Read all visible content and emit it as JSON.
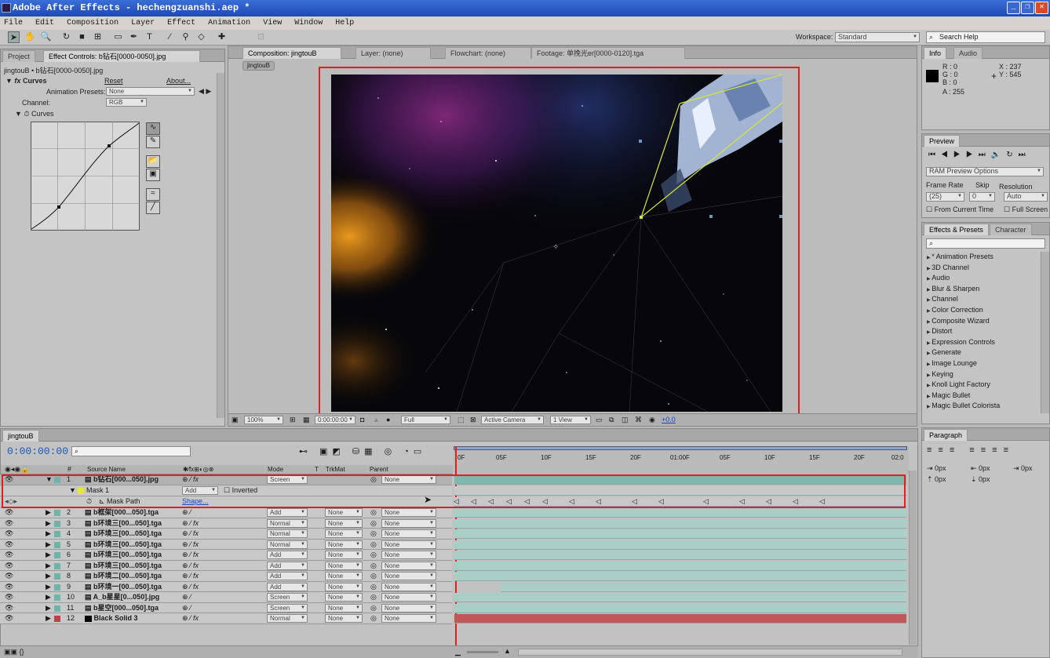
{
  "window": {
    "title": "Adobe After Effects - hechengzuanshi.aep *"
  },
  "menu": [
    "File",
    "Edit",
    "Composition",
    "Layer",
    "Effect",
    "Animation",
    "View",
    "Window",
    "Help"
  ],
  "workspace": {
    "label": "Workspace:",
    "value": "Standard"
  },
  "search_help": "Search Help",
  "left_panel": {
    "tabs": [
      "Project",
      "Effect Controls: b钻石[0000-0050].jpg"
    ],
    "breadcrumb": "jingtouB • b钻石[0000-0050].jpg",
    "effect_name": "Curves",
    "reset": "Reset",
    "about": "About...",
    "animation_presets_label": "Animation Presets:",
    "animation_presets_value": "None",
    "channel_label": "Channel:",
    "channel_value": "RGB",
    "curves_label": "Curves"
  },
  "comp_panel": {
    "tabs": [
      "Composition: jingtouB",
      "Layer: (none)",
      "Flowchart: (none)",
      "Footage: 单挽光er[0000-0120].tga"
    ],
    "comp_button": "jingtouB",
    "zoom": "100%",
    "timecode": "0:00:00:00",
    "resolution": "Full",
    "camera": "Active Camera",
    "views": "1 View",
    "exposure": "+0.0"
  },
  "info": {
    "tabs": [
      "Info",
      "Audio"
    ],
    "r": "R : 0",
    "g": "G : 0",
    "b": "B : 0",
    "a": "A : 255",
    "x": "X : 237",
    "y": "Y : 545"
  },
  "preview": {
    "tab": "Preview",
    "ram_options": "RAM Preview Options",
    "frame_rate_label": "Frame Rate",
    "frame_rate": "(25)",
    "skip_label": "Skip",
    "skip": "0",
    "resolution_label": "Resolution",
    "resolution": "Auto",
    "from_current": "From Current Time",
    "full_screen": "Full Screen"
  },
  "effects_presets": {
    "tabs": [
      "Effects & Presets",
      "Character"
    ],
    "items": [
      "* Animation Presets",
      "3D Channel",
      "Audio",
      "Blur & Sharpen",
      "Channel",
      "Color Correction",
      "Composite Wizard",
      "Distort",
      "Expression Controls",
      "Generate",
      "Image Lounge",
      "Keying",
      "Knoll Light Factory",
      "Magic Bullet",
      "Magic Bullet Colorista"
    ]
  },
  "paragraph": {
    "tab": "Paragraph",
    "values": [
      "0px",
      "0px",
      "0px",
      "0px",
      "0px"
    ]
  },
  "timeline": {
    "tab": "jingtouB",
    "timecode": "0:00:00:00",
    "headers": {
      "source": "Source Name",
      "mode": "Mode",
      "t": "T",
      "trkmat": "TrkMat",
      "parent": "Parent",
      "num": "#"
    },
    "ruler": [
      "0F",
      "05F",
      "10F",
      "15F",
      "20F",
      "01:00F",
      "05F",
      "10F",
      "15F",
      "20F",
      "02:0"
    ],
    "layers": [
      {
        "num": "1",
        "name": "b钻石[000...050].jpg",
        "mode": "Screen",
        "trkmat": "",
        "parent": "None",
        "color": "#6fb4a8",
        "fx": true
      },
      {
        "num": "2",
        "name": "b框架[000...050].tga",
        "mode": "Add",
        "trkmat": "None",
        "parent": "None",
        "color": "#6fb4a8",
        "fx": false
      },
      {
        "num": "3",
        "name": "b环境三[00...050].tga",
        "mode": "Normal",
        "trkmat": "None",
        "parent": "None",
        "color": "#6fb4a8",
        "fx": true
      },
      {
        "num": "4",
        "name": "b环境三[00...050].tga",
        "mode": "Normal",
        "trkmat": "None",
        "parent": "None",
        "color": "#6fb4a8",
        "fx": true
      },
      {
        "num": "5",
        "name": "b环境三[00...050].tga",
        "mode": "Normal",
        "trkmat": "None",
        "parent": "None",
        "color": "#6fb4a8",
        "fx": true
      },
      {
        "num": "6",
        "name": "b环境三[00...050].tga",
        "mode": "Add",
        "trkmat": "None",
        "parent": "None",
        "color": "#6fb4a8",
        "fx": true
      },
      {
        "num": "7",
        "name": "b环境三[00...050].tga",
        "mode": "Add",
        "trkmat": "None",
        "parent": "None",
        "color": "#6fb4a8",
        "fx": true
      },
      {
        "num": "8",
        "name": "b环境二[00...050].tga",
        "mode": "Add",
        "trkmat": "None",
        "parent": "None",
        "color": "#6fb4a8",
        "fx": true
      },
      {
        "num": "9",
        "name": "b环境一[00...050].tga",
        "mode": "Add",
        "trkmat": "None",
        "parent": "None",
        "color": "#6fb4a8",
        "fx": true
      },
      {
        "num": "10",
        "name": "A_b星星[0...050].jpg",
        "mode": "Screen",
        "trkmat": "None",
        "parent": "None",
        "color": "#6fb4a8",
        "fx": false
      },
      {
        "num": "11",
        "name": "b星空[000...050].tga",
        "mode": "Screen",
        "trkmat": "None",
        "parent": "None",
        "color": "#6fb4a8",
        "fx": false
      },
      {
        "num": "12",
        "name": "Black Solid 3",
        "mode": "Normal",
        "trkmat": "None",
        "parent": "None",
        "color": "#c0404a",
        "fx": true
      }
    ],
    "mask": {
      "name": "Mask 1",
      "mode": "Add",
      "inverted": "Inverted",
      "path_label": "Mask Path",
      "path_value": "Shape..."
    }
  },
  "colors": {
    "highlight": "#e02020",
    "mask_outline": "#d8e830",
    "accent_blue": "#1346c9"
  }
}
